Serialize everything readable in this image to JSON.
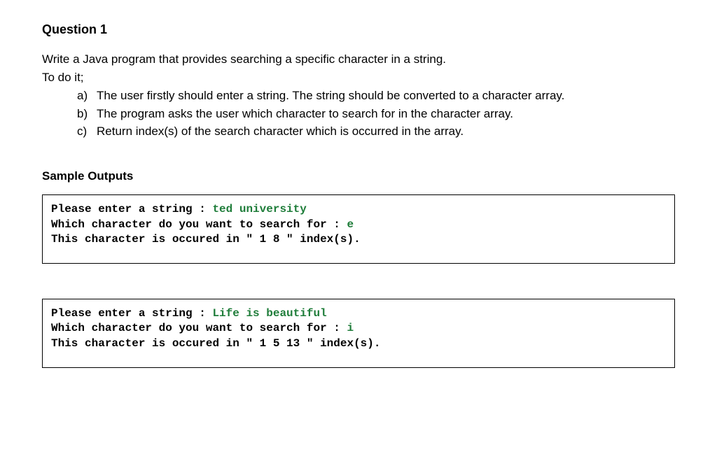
{
  "title": "Question 1",
  "intro": "Write a Java program that provides searching a specific character in a string.",
  "todoLabel": "To do it;",
  "items": {
    "a": {
      "marker": "a)",
      "text": "The user firstly should enter a string. The string should be converted to a character array."
    },
    "b": {
      "marker": "b)",
      "text": "The program asks the user which character to search for in the character array."
    },
    "c": {
      "marker": "c)",
      "text": "Return index(s) of the search character which is occurred in the array."
    }
  },
  "sampleTitle": "Sample Outputs",
  "output1": {
    "line1prompt": "Please enter a string : ",
    "line1input": "ted university",
    "line2prompt": "Which character do you want to search for : ",
    "line2input": "e",
    "line3": "This character is occured in \" 1 8 \" index(s)."
  },
  "output2": {
    "line1prompt": "Please enter a string : ",
    "line1input": "Life is beautiful",
    "line2prompt": "Which character do you want to search for : ",
    "line2input": "i",
    "line3": "This character is occured in \" 1 5 13 \" index(s)."
  }
}
